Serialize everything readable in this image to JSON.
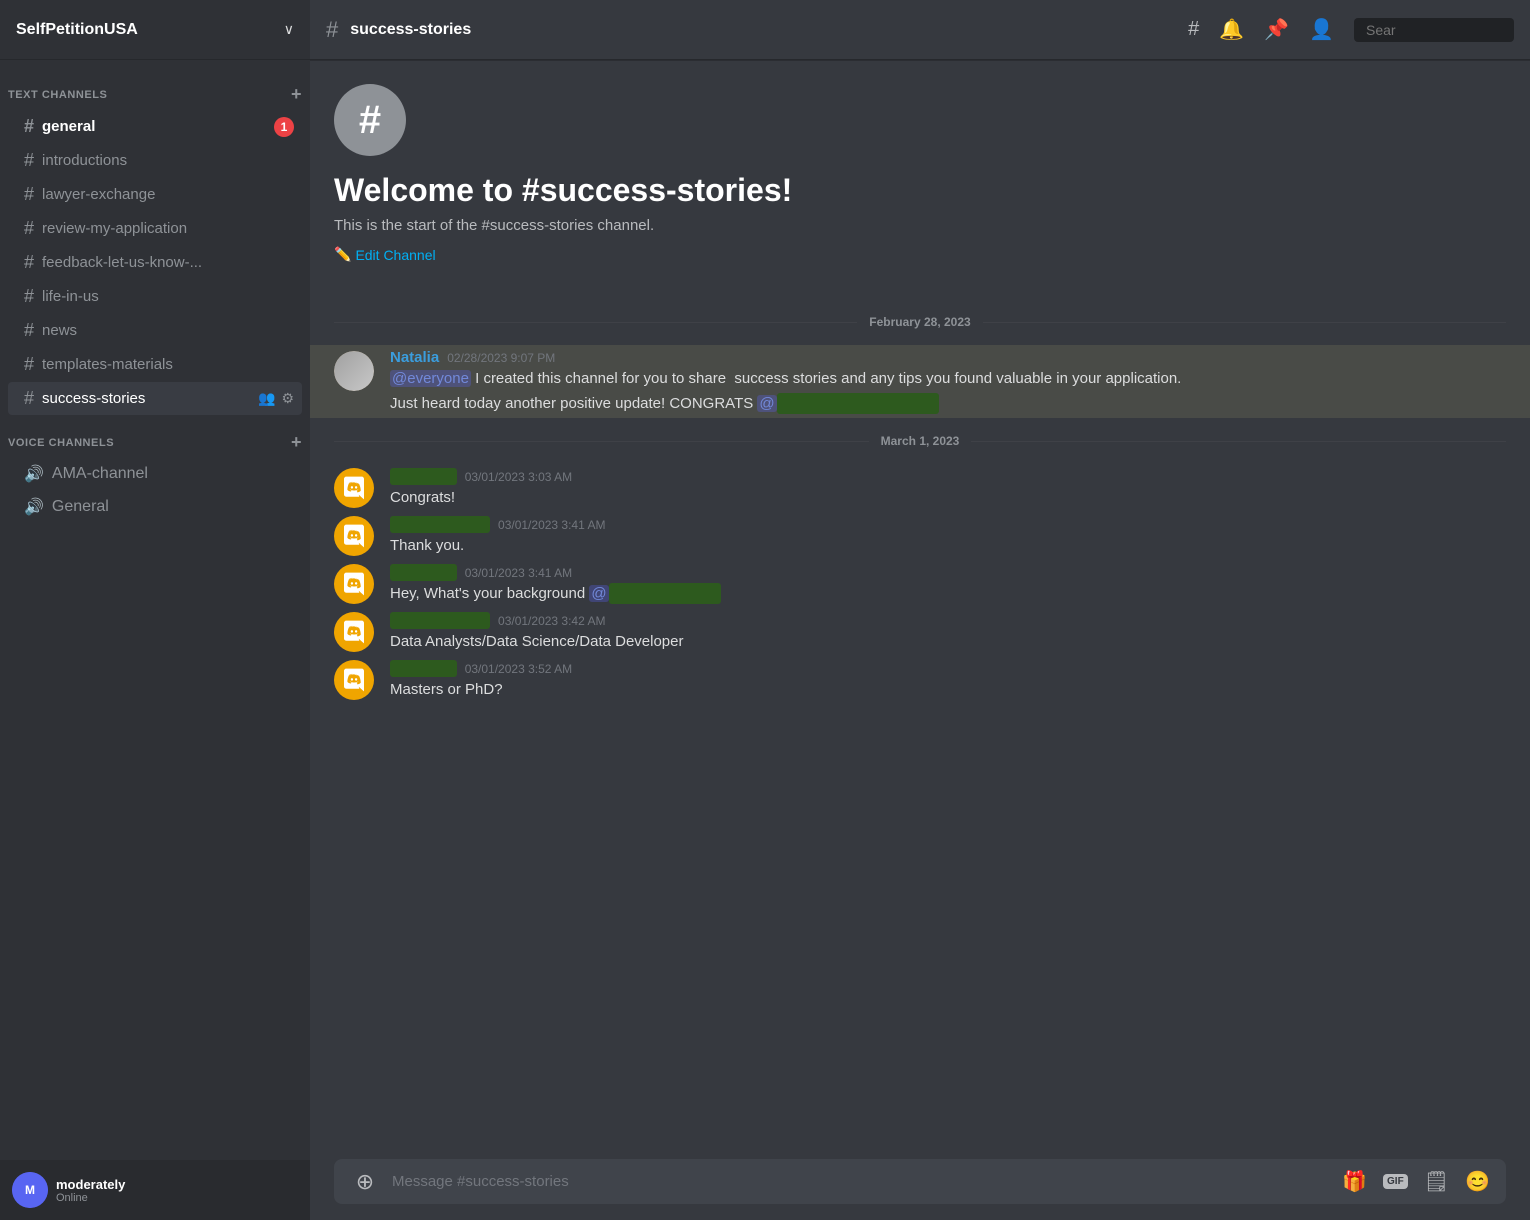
{
  "server": {
    "name": "SelfPetitionUSA",
    "chevron": "∨"
  },
  "sidebar": {
    "text_channels_label": "TEXT CHANNELS",
    "voice_channels_label": "VOICE CHANNELS",
    "channels": [
      {
        "name": "general",
        "type": "text",
        "active": false,
        "notification": 1
      },
      {
        "name": "introductions",
        "type": "text",
        "active": false,
        "notification": 0
      },
      {
        "name": "lawyer-exchange",
        "type": "text",
        "active": false,
        "notification": 0
      },
      {
        "name": "review-my-application",
        "type": "text",
        "active": false,
        "notification": 0
      },
      {
        "name": "feedback-let-us-know-...",
        "type": "text",
        "active": false,
        "notification": 0
      },
      {
        "name": "life-in-us",
        "type": "text",
        "active": false,
        "notification": 0
      },
      {
        "name": "news",
        "type": "text",
        "active": false,
        "notification": 0
      },
      {
        "name": "templates-materials",
        "type": "text",
        "active": false,
        "notification": 0
      },
      {
        "name": "success-stories",
        "type": "text",
        "active": true,
        "notification": 0
      }
    ],
    "voice_channels": [
      {
        "name": "AMA-channel",
        "type": "voice"
      },
      {
        "name": "General",
        "type": "voice"
      }
    ],
    "user": {
      "username": "moderately",
      "status": "Online"
    }
  },
  "channel": {
    "name": "success-stories",
    "welcome_title": "Welcome to #success-stories!",
    "welcome_subtitle": "This is the start of the #success-stories channel.",
    "edit_channel_label": "Edit Channel"
  },
  "search": {
    "placeholder": "Sear"
  },
  "date_dividers": [
    "February 28, 2023",
    "March 1, 2023"
  ],
  "messages": [
    {
      "id": "msg1",
      "author": "Natalia",
      "author_type": "named",
      "timestamp": "02/28/2023 9:07 PM",
      "lines": [
        "@everyone I created this channel for you to share  success stories and any tips you found valuable in your application.",
        "Just heard today another positive update! CONGRATS @████████████"
      ],
      "highlighted": true,
      "date_group": "February 28, 2023"
    },
    {
      "id": "msg2",
      "author": "████████",
      "author_type": "blurred",
      "timestamp": "03/01/2023 3:03 AM",
      "lines": [
        "Congrats!"
      ],
      "highlighted": false,
      "date_group": "March 1, 2023"
    },
    {
      "id": "msg3",
      "author": "████████████",
      "author_type": "blurred",
      "timestamp": "03/01/2023 3:41 AM",
      "lines": [
        "Thank you."
      ],
      "highlighted": false,
      "date_group": "March 1, 2023"
    },
    {
      "id": "msg4",
      "author": "████████",
      "author_type": "blurred",
      "timestamp": "03/01/2023 3:41 AM",
      "lines": [
        "Hey, What's your background @████████████"
      ],
      "highlighted": false,
      "date_group": "March 1, 2023"
    },
    {
      "id": "msg5",
      "author": "████████████",
      "author_type": "blurred",
      "timestamp": "03/01/2023 3:42 AM",
      "lines": [
        "Data Analysts/Data Science/Data Developer"
      ],
      "highlighted": false,
      "date_group": "March 1, 2023"
    },
    {
      "id": "msg6",
      "author": "████████",
      "author_type": "blurred",
      "timestamp": "03/01/2023 3:52 AM",
      "lines": [
        "Masters or PhD?"
      ],
      "highlighted": false,
      "date_group": "March 1, 2023"
    }
  ],
  "input": {
    "placeholder": "Message #success-stories"
  },
  "icons": {
    "hash": "#",
    "bell": "🔔",
    "pin": "📌",
    "people": "👤",
    "pencil": "✏️",
    "add": "➕",
    "gift": "🎁",
    "gif": "GIF",
    "sticker": "🗒",
    "emoji": "😊"
  }
}
